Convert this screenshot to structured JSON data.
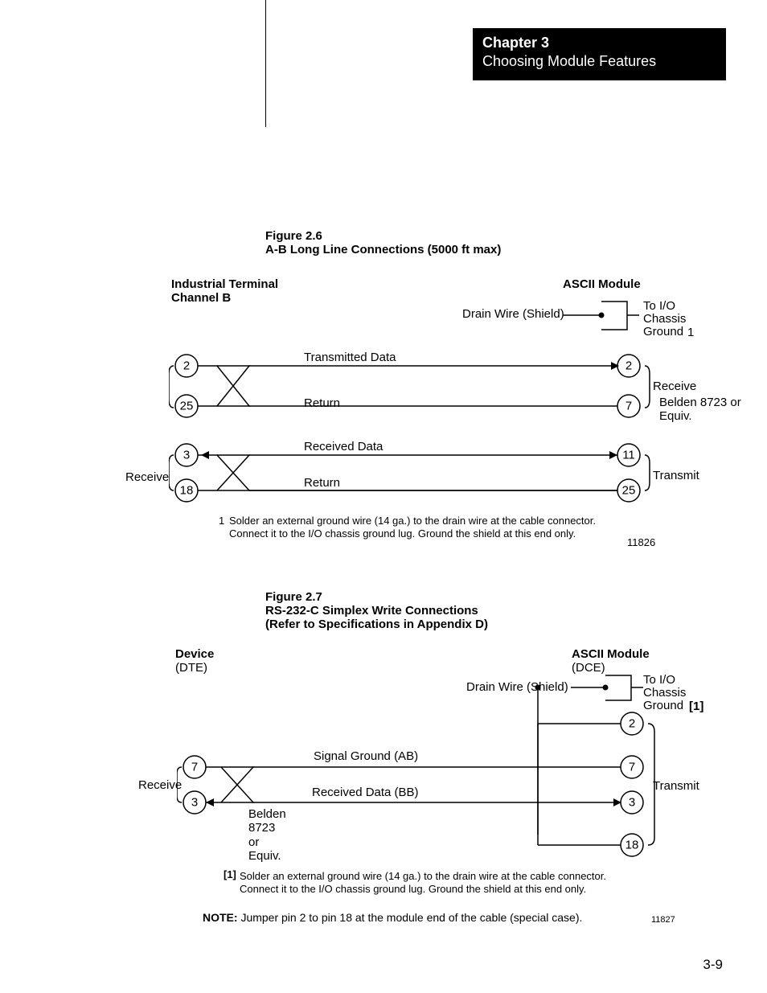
{
  "header": {
    "chapter": "Chapter 3",
    "subtitle": "Choosing Module Features"
  },
  "fig1": {
    "caption_line1": "Figure 2.6",
    "caption_line2": "A-B Long Line Connections (5000 ft max)",
    "left_title_l1": "Industrial Terminal",
    "left_title_l2": "Channel B",
    "right_title": "ASCII Module",
    "drain_wire": "Drain Wire (Shield)",
    "to_io_1": "To I/O",
    "to_io_2": "Chassis",
    "to_io_3": "Ground",
    "ref_1": "1",
    "belden": "Belden 8723 or Equiv.",
    "tx_label": "Transmitted Data",
    "ret_label": "Return",
    "rx_label": "Received Data",
    "receive_side_top": "Receive",
    "receive_side_bottom": "Receive",
    "transmit_side": "Transmit",
    "pins": {
      "l1": "2",
      "l2": "25",
      "l3": "3",
      "l4": "18",
      "r1": "2",
      "r2": "7",
      "r3": "11",
      "r4": "25"
    },
    "foot_ref": "1",
    "foot_line1": "Solder an external ground wire (14 ga.) to the drain wire at the cable connector.",
    "foot_line2": "Connect it to the I/O chassis ground lug. Ground the shield at this end only.",
    "diagno": "11826"
  },
  "fig2": {
    "caption_line1": "Figure 2.7",
    "caption_line2": "RS-232-C Simplex Write Connections",
    "caption_line3": "(Refer to Specifications in Appendix D)",
    "left_title_l1": "Device",
    "left_title_l2": "(DTE)",
    "right_title_l1": "ASCII Module",
    "right_title_l2": "(DCE)",
    "drain_wire": "Drain Wire (Shield)",
    "to_io_1": "To I/O",
    "to_io_2": "Chassis",
    "to_io_3": "Ground",
    "ref_1": "[1]",
    "sig_gnd": "Signal Ground (AB)",
    "rx_bb": "Received Data (BB)",
    "receive": "Receive",
    "transmit": "Transmit",
    "belden_l1": "Belden",
    "belden_l2": "8723",
    "belden_l3": "or",
    "belden_l4": "Equiv.",
    "pins": {
      "l1": "7",
      "l2": "3",
      "r0": "2",
      "r1": "7",
      "r2": "3",
      "r3": "18"
    },
    "foot_ref": "[1]",
    "foot_line1": "Solder an external ground wire (14 ga.) to the drain wire at the cable connector.",
    "foot_line2": "Connect it to the I/O chassis ground lug. Ground the shield at this end only.",
    "note_bold": "NOTE:",
    "note_text": " Jumper pin 2 to pin 18 at the module end of the cable (special case).",
    "diagno": "11827"
  },
  "page_number": "3-9"
}
